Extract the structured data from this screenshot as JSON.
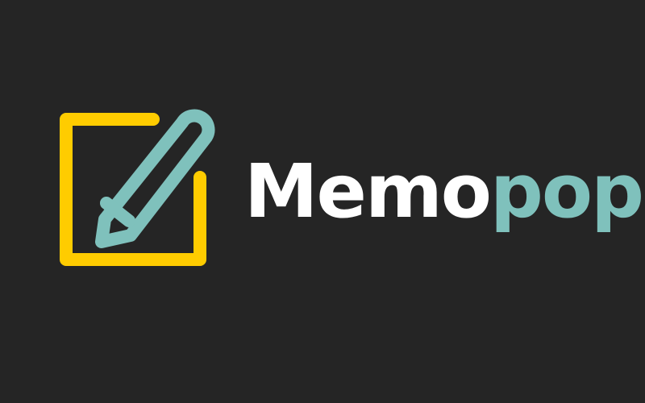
{
  "logo": {
    "wordmark_part1": "Memo",
    "wordmark_part2": "pop",
    "icon": "note-pencil-icon",
    "colors": {
      "background": "#252525",
      "square": "#ffcc00",
      "pencil": "#7fc1bc",
      "text_primary": "#ffffff",
      "text_accent": "#7fc1bc"
    }
  }
}
